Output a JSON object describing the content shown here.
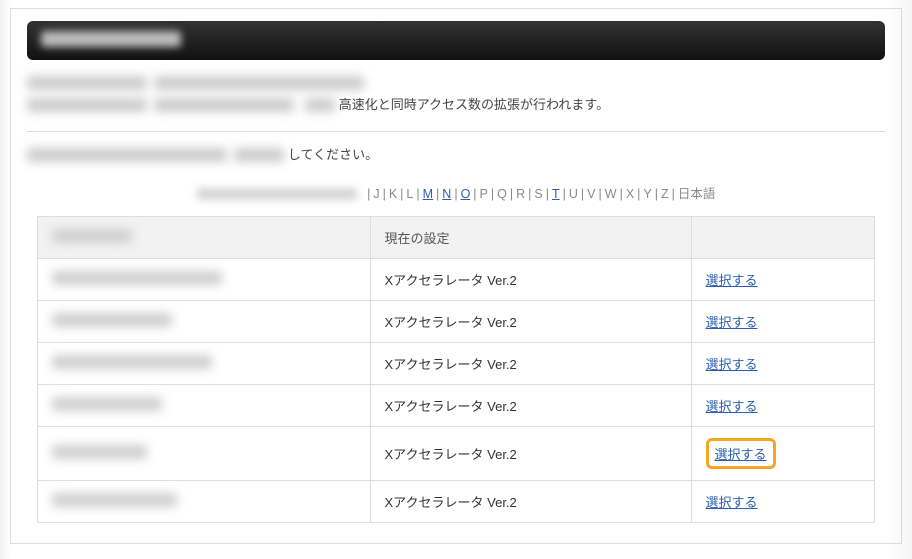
{
  "intro": {
    "line2_visible": "高速化と同時アクセス数の拡張が行われます。"
  },
  "instruction": {
    "visible_suffix": "してください。"
  },
  "alpha_nav": {
    "letters": [
      {
        "label": "J",
        "link": false
      },
      {
        "label": "K",
        "link": false
      },
      {
        "label": "L",
        "link": false
      },
      {
        "label": "M",
        "link": true
      },
      {
        "label": "N",
        "link": true
      },
      {
        "label": "O",
        "link": true
      },
      {
        "label": "P",
        "link": false
      },
      {
        "label": "Q",
        "link": false
      },
      {
        "label": "R",
        "link": false
      },
      {
        "label": "S",
        "link": false
      },
      {
        "label": "T",
        "link": true
      },
      {
        "label": "U",
        "link": false
      },
      {
        "label": "V",
        "link": false
      },
      {
        "label": "W",
        "link": false
      },
      {
        "label": "X",
        "link": false
      },
      {
        "label": "Y",
        "link": false
      },
      {
        "label": "Z",
        "link": false
      },
      {
        "label": "日本語",
        "link": false
      }
    ]
  },
  "table": {
    "headers": {
      "domain": "",
      "setting": "現在の設定",
      "action": ""
    },
    "rows": [
      {
        "domain_blur_w": 170,
        "setting": "Xアクセラレータ Ver.2",
        "action": "選択する",
        "highlight": false
      },
      {
        "domain_blur_w": 120,
        "setting": "Xアクセラレータ Ver.2",
        "action": "選択する",
        "highlight": false
      },
      {
        "domain_blur_w": 160,
        "setting": "Xアクセラレータ Ver.2",
        "action": "選択する",
        "highlight": false
      },
      {
        "domain_blur_w": 110,
        "setting": "Xアクセラレータ Ver.2",
        "action": "選択する",
        "highlight": false
      },
      {
        "domain_blur_w": 95,
        "setting": "Xアクセラレータ Ver.2",
        "action": "選択する",
        "highlight": true
      },
      {
        "domain_blur_w": 125,
        "setting": "Xアクセラレータ Ver.2",
        "action": "選択する",
        "highlight": false
      }
    ]
  }
}
